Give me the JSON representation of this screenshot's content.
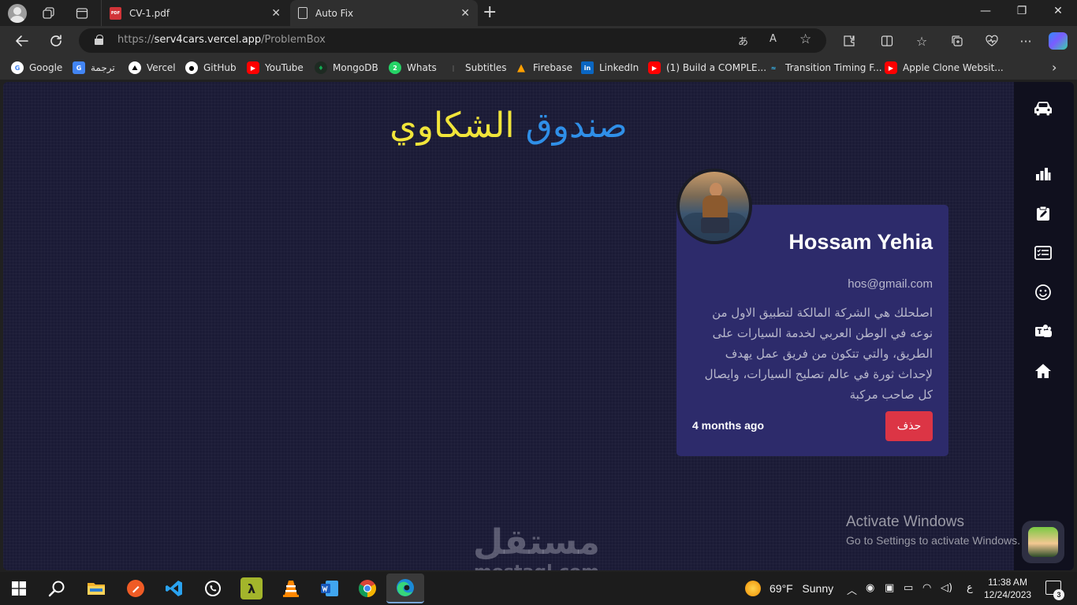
{
  "browser": {
    "tabs": [
      {
        "title": "CV-1.pdf",
        "icon": "pdf-icon",
        "active": false
      },
      {
        "title": "Auto Fix",
        "icon": "page-icon",
        "active": true
      }
    ],
    "url_prefix": "https://",
    "url_host": "serv4cars.vercel.app",
    "url_path": "/ProblemBox",
    "bookmarks": [
      {
        "label": "Google",
        "icon": "google-icon",
        "color": "#ffffff"
      },
      {
        "label": "ترجمة",
        "icon": "translate-icon",
        "color": "#4285f4"
      },
      {
        "label": "Vercel",
        "icon": "vercel-icon",
        "color": "#000000"
      },
      {
        "label": "GitHub",
        "icon": "github-icon",
        "color": "#ffffff"
      },
      {
        "label": "YouTube",
        "icon": "youtube-icon",
        "color": "#ff0000"
      },
      {
        "label": "MongoDB",
        "icon": "mongodb-icon",
        "color": "#13aa52"
      },
      {
        "label": "Whats",
        "icon": "whatsapp-icon",
        "color": "#25d366"
      },
      {
        "label": "Subtitles",
        "icon": "subtitles-icon",
        "color": "#555555"
      },
      {
        "label": "Firebase",
        "icon": "firebase-icon",
        "color": "#ffa000"
      },
      {
        "label": "LinkedIn",
        "icon": "linkedin-icon",
        "color": "#0a66c2"
      },
      {
        "label": "(1) Build a COMPLE...",
        "icon": "youtube-icon",
        "color": "#ff0000"
      },
      {
        "label": "Transition Timing F...",
        "icon": "tailwind-icon",
        "color": "#38bdf8"
      },
      {
        "label": "Apple Clone Websit...",
        "icon": "youtube-icon",
        "color": "#ff0000"
      }
    ]
  },
  "page": {
    "title_word1": "صندوق",
    "title_word2": "الشكاوي",
    "title_word1_color": "#2f8fe8",
    "title_word2_color": "#f1e53a",
    "complaint": {
      "name": "Hossam Yehia",
      "email": "hos@gmail.com",
      "message": "اصلحلك هي الشركة المالكة لتطبيق الاول من نوعه في الوطن العربي لخدمة السيارات على الطريق، والتي تتكون من فريق عمل يهدف لإحداث ثورة في عالم تصليح السيارات، وايصال كل صاحب مركبة",
      "time": "4 months ago",
      "delete_label": "حذف"
    },
    "sidebar_icons": [
      "car-icon",
      "stats-icon",
      "edit-icon",
      "list-icon",
      "smile-icon",
      "team-icon",
      "home-icon"
    ]
  },
  "overlay": {
    "activate_title": "Activate Windows",
    "activate_sub": "Go to Settings to activate Windows.",
    "watermark_ar": "مستقل",
    "watermark_en": "mostaql.com"
  },
  "taskbar": {
    "weather_temp": "69°F",
    "weather_text": "Sunny",
    "lang": "ع",
    "time": "11:38 AM",
    "date": "12/24/2023",
    "notifications": "3"
  }
}
